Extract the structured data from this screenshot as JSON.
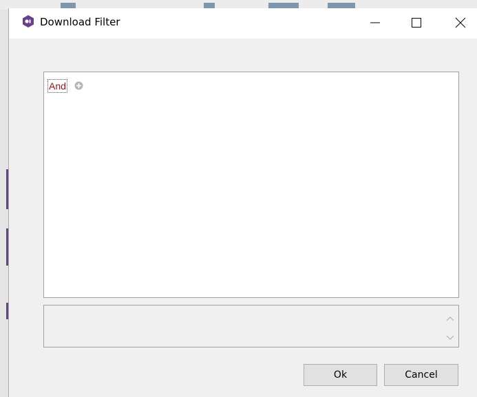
{
  "window": {
    "title": "Download Filter",
    "app_icon": "app-logo-icon",
    "controls": [
      "minimize-icon",
      "maximize-icon",
      "close-icon"
    ]
  },
  "filter_editor": {
    "root_operator": "And",
    "operator_color": "#a31515",
    "add_icon": "plus-circle-icon"
  },
  "text_area": {
    "value": "",
    "scroll_icons": [
      "chevron-up-icon",
      "chevron-down-icon"
    ]
  },
  "buttons": {
    "ok_label": "Ok",
    "cancel_label": "Cancel"
  },
  "colors": {
    "accent": "#6b3f8e",
    "dialog_bg": "#f0f0f0"
  }
}
